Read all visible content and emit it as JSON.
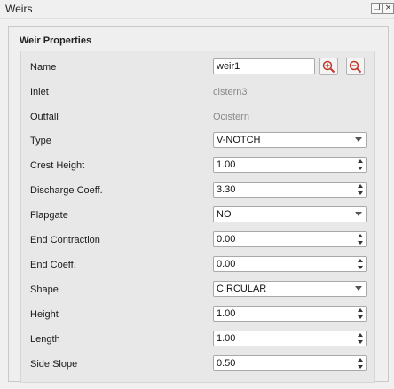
{
  "window": {
    "title": "Weirs",
    "float_icon": "float-icon",
    "close_icon": "close-icon"
  },
  "panel": {
    "title": "Weir Properties"
  },
  "props": {
    "name": {
      "label": "Name",
      "value": "weir1"
    },
    "inlet": {
      "label": "Inlet",
      "value": "cistern3"
    },
    "outfall": {
      "label": "Outfall",
      "value": "Ocistern"
    },
    "type": {
      "label": "Type",
      "value": "V-NOTCH"
    },
    "crest_height": {
      "label": "Crest Height",
      "value": "1.00"
    },
    "discharge_coeff": {
      "label": "Discharge Coeff.",
      "value": "3.30"
    },
    "flapgate": {
      "label": "Flapgate",
      "value": "NO"
    },
    "end_contraction": {
      "label": "End Contraction",
      "value": "0.00"
    },
    "end_coeff": {
      "label": "End Coeff.",
      "value": "0.00"
    },
    "shape": {
      "label": "Shape",
      "value": "CIRCULAR"
    },
    "height": {
      "label": "Height",
      "value": "1.00"
    },
    "length": {
      "label": "Length",
      "value": "1.00"
    },
    "side_slope": {
      "label": "Side Slope",
      "value": "0.50"
    }
  },
  "icons": {
    "zoom_in": "zoom-in-icon",
    "zoom_out": "zoom-out-icon"
  },
  "colors": {
    "zoom_accent": "#c0392b"
  }
}
